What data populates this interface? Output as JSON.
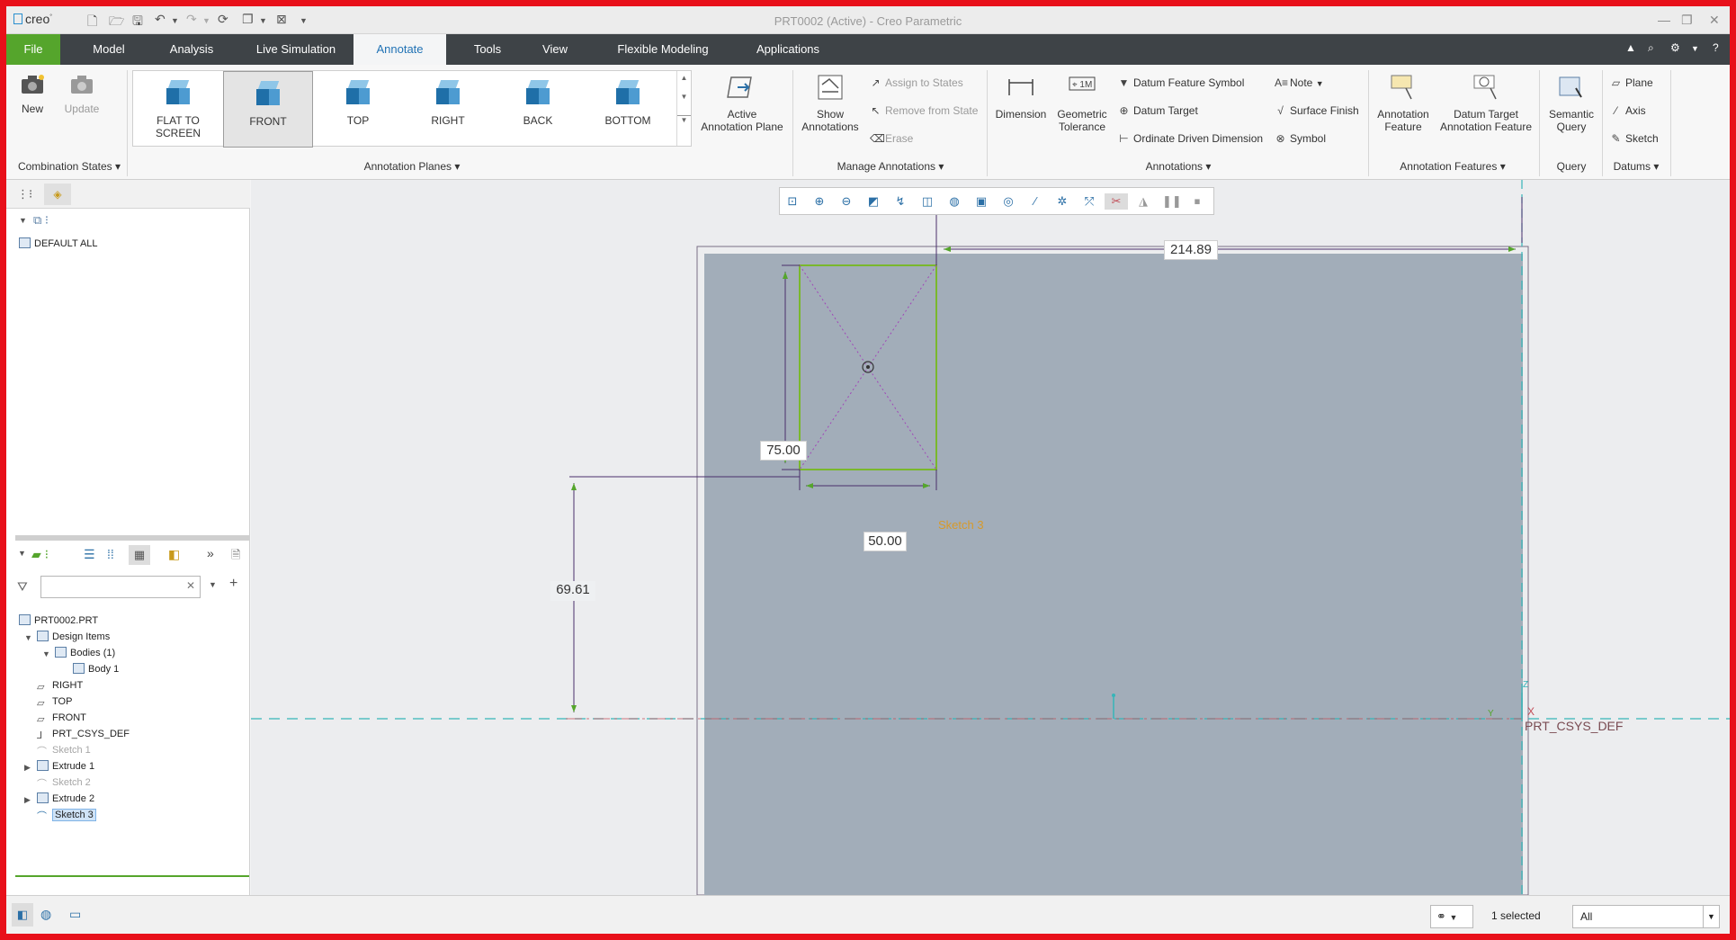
{
  "titlebar": {
    "logo": "creo",
    "title": "PRT0002 (Active) - Creo Parametric"
  },
  "tabs": [
    "File",
    "Model",
    "Analysis",
    "Live Simulation",
    "Annotate",
    "Tools",
    "View",
    "Flexible Modeling",
    "Applications"
  ],
  "ribbon": {
    "combination_states": {
      "new": "New",
      "update": "Update",
      "label": "Combination States"
    },
    "planes": [
      "FLAT TO SCREEN",
      "FRONT",
      "TOP",
      "RIGHT",
      "BACK",
      "BOTTOM"
    ],
    "planes_label": "Annotation Planes",
    "active_plane_line1": "Active",
    "active_plane_line2": "Annotation Plane",
    "manage": {
      "show_line1": "Show",
      "show_line2": "Annotations",
      "assign": "Assign to States",
      "remove": "Remove from State",
      "erase": "Erase",
      "label": "Manage Annotations"
    },
    "annotations": {
      "dimension": "Dimension",
      "geom_line1": "Geometric",
      "geom_line2": "Tolerance",
      "datum_feature_symbol": "Datum Feature Symbol",
      "datum_target": "Datum Target",
      "ordinate": "Ordinate Driven Dimension",
      "note": "Note",
      "surface_finish": "Surface Finish",
      "symbol": "Symbol",
      "label": "Annotations"
    },
    "annotation_features": {
      "af_line1": "Annotation",
      "af_line2": "Feature",
      "dt_line1": "Datum Target",
      "dt_line2": "Annotation Feature",
      "label": "Annotation Features"
    },
    "query": {
      "line1": "Semantic",
      "line2": "Query",
      "label": "Query"
    },
    "datums": {
      "plane": "Plane",
      "axis": "Axis",
      "sketch": "Sketch",
      "label": "Datums"
    }
  },
  "left_panel": {
    "layer_item": "DEFAULT ALL",
    "filter_placeholder": "",
    "model_tree": [
      {
        "label": "PRT0002.PRT",
        "state": "normal"
      },
      {
        "label": "Design Items",
        "state": "normal"
      },
      {
        "label": "Bodies (1)",
        "state": "normal"
      },
      {
        "label": "Body 1",
        "state": "normal"
      },
      {
        "label": "RIGHT",
        "state": "normal"
      },
      {
        "label": "TOP",
        "state": "normal"
      },
      {
        "label": "FRONT",
        "state": "normal"
      },
      {
        "label": "PRT_CSYS_DEF",
        "state": "normal"
      },
      {
        "label": "Sketch 1",
        "state": "disabled"
      },
      {
        "label": "Extrude 1",
        "state": "normal"
      },
      {
        "label": "Sketch 2",
        "state": "disabled"
      },
      {
        "label": "Extrude 2",
        "state": "normal"
      },
      {
        "label": "Sketch 3",
        "state": "selected"
      }
    ]
  },
  "graphics": {
    "dim_width_top": "214.89",
    "dim_height": "75.00",
    "dim_width": "50.00",
    "dim_offset": "69.61",
    "sketch_label": "Sketch 3",
    "csys_label": "PRT_CSYS_DEF",
    "csys_axis_x": "X"
  },
  "status": {
    "selected": "1 selected",
    "filter_value": "All"
  },
  "colors": {
    "tabbar": "#3e4347",
    "file_tab": "#55a52c",
    "part_face": "#a2adb9",
    "sketch_green": "#7ab82c",
    "dimension_purple": "#4a2e6b",
    "frame_red": "#e8101a"
  }
}
